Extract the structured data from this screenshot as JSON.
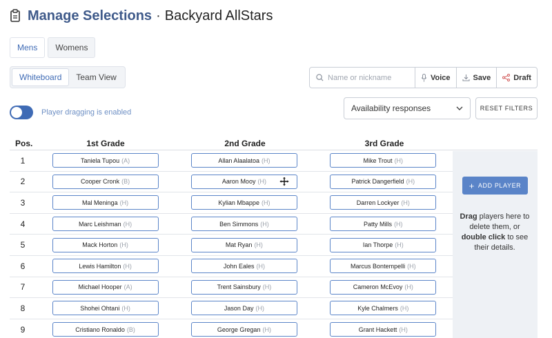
{
  "header": {
    "icon": "clipboard-icon",
    "title": "Manage Selections",
    "separator": "·",
    "team": "Backyard AllStars"
  },
  "gender_tabs": [
    {
      "label": "Mens",
      "active": true
    },
    {
      "label": "Womens",
      "active": false
    }
  ],
  "view_tabs": [
    {
      "label": "Whiteboard",
      "active": true
    },
    {
      "label": "Team View",
      "active": false
    }
  ],
  "toggle": {
    "label": "Player dragging is enabled",
    "enabled": true
  },
  "toolbar": {
    "search_placeholder": "Name or nickname",
    "voice_label": "Voice",
    "save_label": "Save",
    "draft_label": "Draft"
  },
  "filters": {
    "availability_label": "Availability responses",
    "reset_label": "RESET FILTERS"
  },
  "table": {
    "headers": {
      "pos": "Pos.",
      "grade1": "1st Grade",
      "grade2": "2nd Grade",
      "grade3": "3rd Grade"
    },
    "rows": [
      {
        "pos": "1",
        "g1": {
          "name": "Taniela Tupou",
          "code": "(A)"
        },
        "g2": {
          "name": "Allan Alaalatoa",
          "code": "(H)"
        },
        "g3": {
          "name": "Mike Trout",
          "code": "(H)"
        }
      },
      {
        "pos": "2",
        "g1": {
          "name": "Cooper Cronk",
          "code": "(B)"
        },
        "g2": {
          "name": "Aaron Mooy",
          "code": "(H)"
        },
        "g3": {
          "name": "Patrick Dangerfield",
          "code": "(H)"
        }
      },
      {
        "pos": "3",
        "g1": {
          "name": "Mal Meninga",
          "code": "(H)"
        },
        "g2": {
          "name": "Kylian Mbappe",
          "code": "(H)"
        },
        "g3": {
          "name": "Darren Lockyer",
          "code": "(H)"
        }
      },
      {
        "pos": "4",
        "g1": {
          "name": "Marc Leishman",
          "code": "(H)"
        },
        "g2": {
          "name": "Ben Simmons",
          "code": "(H)"
        },
        "g3": {
          "name": "Patty Mills",
          "code": "(H)"
        }
      },
      {
        "pos": "5",
        "g1": {
          "name": "Mack Horton",
          "code": "(H)"
        },
        "g2": {
          "name": "Mat Ryan",
          "code": "(H)"
        },
        "g3": {
          "name": "Ian Thorpe",
          "code": "(H)"
        }
      },
      {
        "pos": "6",
        "g1": {
          "name": "Lewis Hamilton",
          "code": "(H)"
        },
        "g2": {
          "name": "John Eales",
          "code": "(H)"
        },
        "g3": {
          "name": "Marcus Bontempelli",
          "code": "(H)"
        }
      },
      {
        "pos": "7",
        "g1": {
          "name": "Michael Hooper",
          "code": "(A)"
        },
        "g2": {
          "name": "Trent Sainsbury",
          "code": "(H)"
        },
        "g3": {
          "name": "Cameron McEvoy",
          "code": "(H)"
        }
      },
      {
        "pos": "8",
        "g1": {
          "name": "Shohei Ohtani",
          "code": "(H)"
        },
        "g2": {
          "name": "Jason Day",
          "code": "(H)"
        },
        "g3": {
          "name": "Kyle Chalmers",
          "code": "(H)"
        }
      },
      {
        "pos": "9",
        "g1": {
          "name": "Cristiano Ronaldo",
          "code": "(B)"
        },
        "g2": {
          "name": "George Gregan",
          "code": "(H)"
        },
        "g3": {
          "name": "Grant Hackett",
          "code": "(H)"
        }
      }
    ]
  },
  "side_panel": {
    "add_player_label": "ADD PLAYER",
    "help_drag": "Drag",
    "help_text1": " players here to delete them, or ",
    "help_dbl": "double click",
    "help_text2": " to see their details."
  },
  "colors": {
    "accent": "#5a84c8",
    "title": "#3f5a8a",
    "panel_bg": "#eef1f5"
  }
}
